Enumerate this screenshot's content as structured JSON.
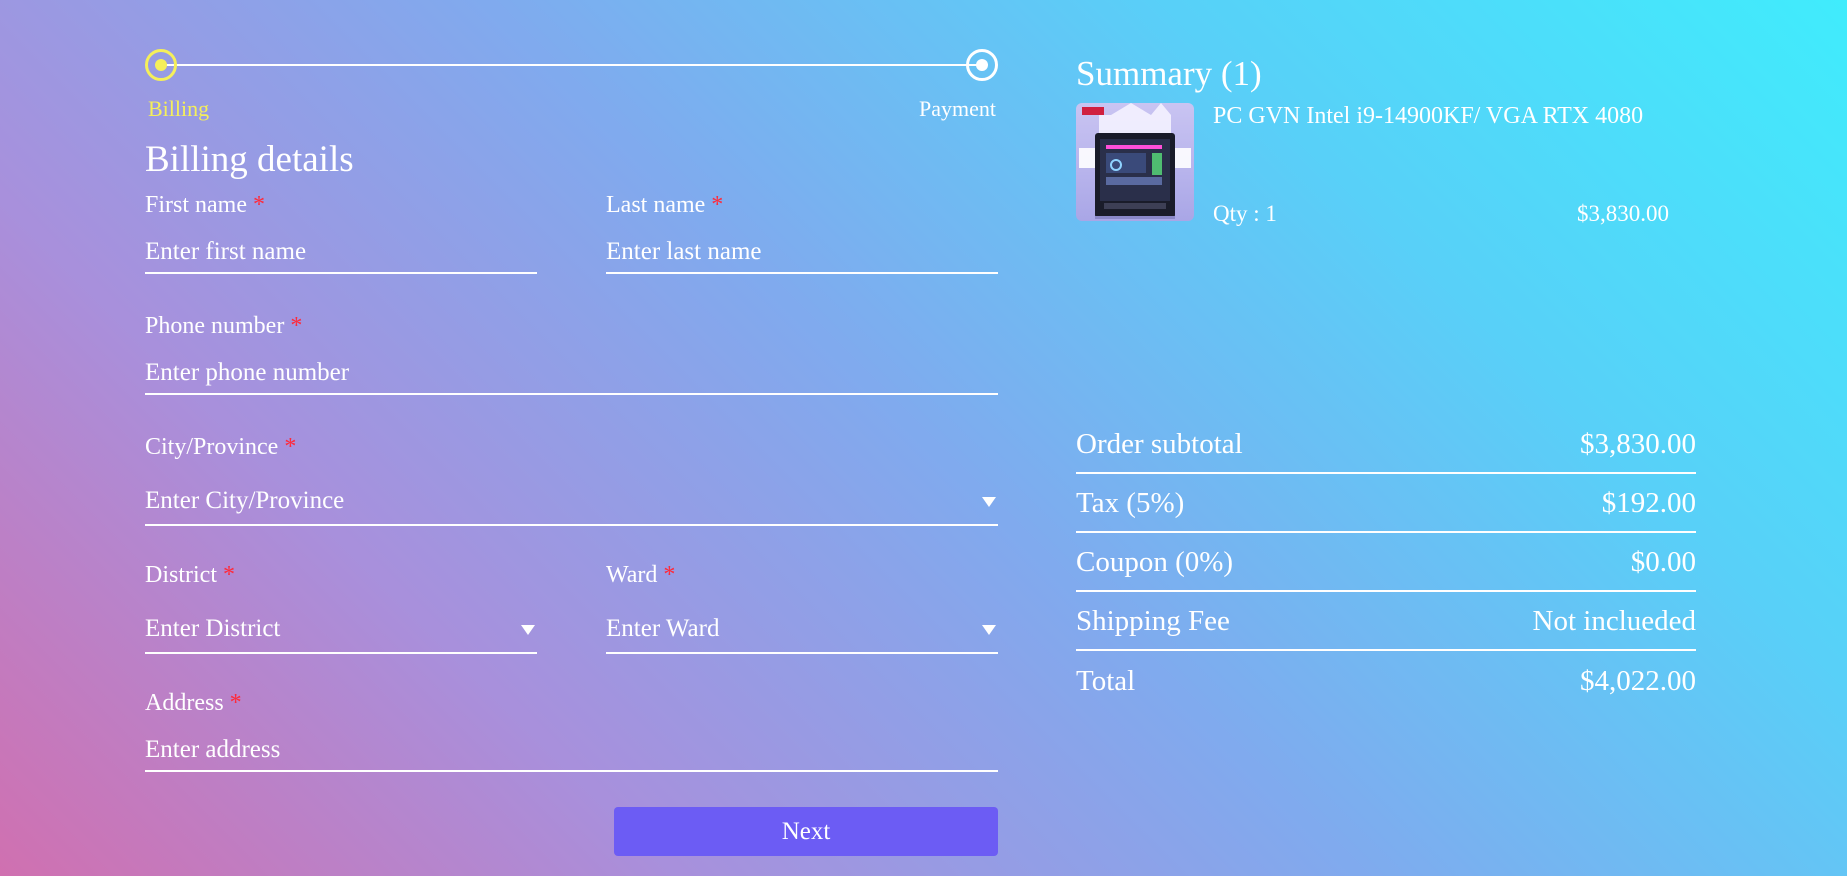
{
  "stepper": {
    "steps": [
      {
        "label": "Billing",
        "state": "active"
      },
      {
        "label": "Payment",
        "state": "pending"
      }
    ],
    "active_color": "#f5ef5a"
  },
  "billing": {
    "title": "Billing details",
    "required_mark": "*",
    "fields": {
      "first_name": {
        "label": "First name",
        "placeholder": "Enter first name",
        "value": ""
      },
      "last_name": {
        "label": "Last name",
        "placeholder": "Enter last name",
        "value": ""
      },
      "phone": {
        "label": "Phone number",
        "placeholder": "Enter phone number",
        "value": ""
      },
      "city": {
        "label": "City/Province",
        "placeholder": "Enter City/Province",
        "value": ""
      },
      "district": {
        "label": "District",
        "placeholder": "Enter District",
        "value": ""
      },
      "ward": {
        "label": "Ward",
        "placeholder": "Enter Ward",
        "value": ""
      },
      "address": {
        "label": "Address",
        "placeholder": "Enter address",
        "value": ""
      }
    },
    "next_label": "Next",
    "button_color": "#6c5cf4"
  },
  "summary": {
    "title": "Summary (1)",
    "items": [
      {
        "name": "PC GVN Intel i9-14900KF/ VGA RTX 4080",
        "qty": "Qty : 1",
        "price": "$3,830.00",
        "image_icon": "pc-case-image"
      }
    ],
    "totals": [
      {
        "label": "Order subtotal",
        "value": "$3,830.00"
      },
      {
        "label": "Tax (5%)",
        "value": "$192.00"
      },
      {
        "label": "Coupon (0%)",
        "value": "$0.00"
      },
      {
        "label": "Shipping Fee",
        "value": "Not inclueded"
      },
      {
        "label": "Total",
        "value": "$4,022.00"
      }
    ]
  }
}
